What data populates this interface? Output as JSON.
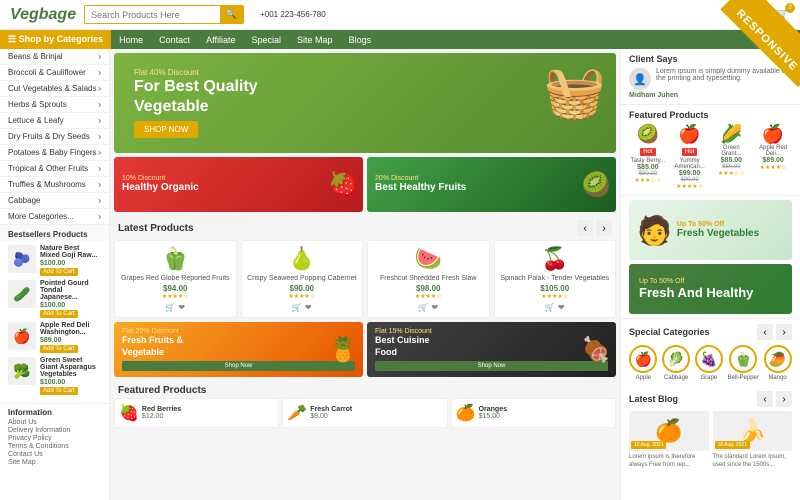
{
  "header": {
    "logo": "Vegbage",
    "search_placeholder": "Search Products Here",
    "phone": "+001 223-456-780",
    "icons": [
      "👤",
      "❤",
      "🛒"
    ],
    "cart_count": "2"
  },
  "nav": {
    "category_label": "☰ Shop by Categories",
    "links": [
      "Home",
      "Contact",
      "Affiliate",
      "Special",
      "Site Map",
      "Blogs"
    ]
  },
  "sidebar": {
    "categories": [
      "Beans & Brinjal",
      "Broccoli & Cauliflower",
      "Cut Vegetables & Salads",
      "Herbs & Sprouts",
      "Lettuce & Leafy",
      "Dry Fruits & Dry Seeds",
      "Potatoes & Baby Fingers",
      "Tropical & Other Fruits",
      "Truffles & Mushrooms",
      "Cabbage",
      "More Categories..."
    ],
    "bestsellers_title": "Bestsellers Products",
    "bestsellers": [
      {
        "name": "Nature Best Mixed Goji Raw...",
        "price": "$100.00",
        "emoji": "🫐"
      },
      {
        "name": "Pointed Gourd Tondal Japanese...",
        "price": "$100.00",
        "emoji": "🥒"
      },
      {
        "name": "Apple Red Deli Washington...",
        "price": "$89.00",
        "emoji": "🍎"
      },
      {
        "name": "Green Sweet Giant Asparagus Vegetables",
        "price": "$100.00",
        "emoji": "🥦"
      }
    ],
    "add_to_cart": "Add To Cart",
    "info_title": "Information",
    "info_links": [
      "About Us",
      "Delivery Information",
      "Privacy Policy",
      "Terms & Conditions",
      "Contact Us",
      "Site Map"
    ],
    "client_says_title": "Client Says"
  },
  "hero": {
    "discount_text": "Flat 40% Discount",
    "title": "For Best Quality\nVegetable",
    "btn_label": "SHOP NOW",
    "emoji": "🧺"
  },
  "small_banners": [
    {
      "discount": "10% Discount",
      "title": "Healthy Organic",
      "emoji": "🍓",
      "class": "banner-red"
    },
    {
      "discount": "20% Discount",
      "title": "Best Healthy Fruits",
      "emoji": "🥝",
      "class": "banner-green"
    }
  ],
  "latest_products": {
    "title": "Latest Products",
    "products": [
      {
        "name": "Grapes Red Globe Reported Fruits",
        "price": "$94.00",
        "emoji": "🫑",
        "rating": "★★★★☆"
      },
      {
        "name": "Crispy Seaweed Popping Cabernet",
        "price": "$90.00",
        "emoji": "🍐",
        "rating": "★★★★☆"
      },
      {
        "name": "Freshcut Shredded Fresh Slaw",
        "price": "$98.00",
        "emoji": "🍉",
        "rating": "★★★★☆"
      },
      {
        "name": "Spinach Palak - Tender Vegetables",
        "price": "$105.00",
        "emoji": "🍒",
        "rating": "★★★★☆"
      }
    ]
  },
  "bottom_banners": [
    {
      "discount": "Flat 20% Discount",
      "title": "Fresh Fruits &\nVegetable",
      "btn": "Shop Now",
      "emoji": "🍍"
    },
    {
      "discount": "Flat 15% Discount",
      "title": "Best Cuisine\nFood",
      "btn": "Shop Now",
      "emoji": "🍖"
    }
  ],
  "featured_bottom": {
    "title": "Featured Products",
    "items": [
      {
        "emoji": "🍓",
        "name": "Red Berries",
        "price": "$12.00"
      },
      {
        "emoji": "🥕",
        "name": "Fresh Carrot",
        "price": "$8.00"
      },
      {
        "emoji": "🍊",
        "name": "Oranges",
        "price": "$15.00"
      }
    ]
  },
  "right_panel": {
    "client_says": {
      "title": "Client Says",
      "avatar": "👤",
      "text": "Lorem ipsum is simply dummy available of the printing and typesetting.",
      "author": "Midham Juhen"
    },
    "featured_products": {
      "title": "Featured Products",
      "products": [
        {
          "emoji": "🥝",
          "badge": "Hot",
          "name": "Tasty Berry...",
          "price": "$85.00",
          "old_price": "$80.00",
          "rating": "★★★☆☆"
        },
        {
          "emoji": "🍎",
          "badge": "Hot",
          "name": "Yummy American...",
          "price": "$99.00",
          "old_price": "$90.00",
          "rating": "★★★★☆"
        },
        {
          "emoji": "🌽",
          "badge": "",
          "name": "Green Grant...",
          "price": "$85.00",
          "old_price": "$80.00",
          "rating": "★★★☆☆"
        },
        {
          "emoji": "🍎",
          "badge": "",
          "name": "Apple Red Deli...",
          "price": "$89.00",
          "old_price": "",
          "rating": "★★★★☆"
        }
      ]
    },
    "fresh_veg_banner": {
      "discount": "Up To 50% Off",
      "title": "Fresh Vegetables",
      "person": "🧑"
    },
    "fresh_healthy_banner": {
      "discount": "Up To 50% Off",
      "title": "Fresh And Healthy"
    },
    "special_categories": {
      "title": "Special Categories",
      "items": [
        {
          "label": "Apple",
          "emoji": "🍎"
        },
        {
          "label": "Cabbage",
          "emoji": "🥬"
        },
        {
          "label": "Grape",
          "emoji": "🍇"
        },
        {
          "label": "Bell-Pepper",
          "emoji": "🫑"
        },
        {
          "label": "Mango",
          "emoji": "🥭"
        }
      ]
    },
    "latest_blog": {
      "title": "Latest Blog",
      "posts": [
        {
          "emoji": "🍊",
          "date": "12 Aug, 2021",
          "text": "Lorem ipsum is therefore always Free from rep..."
        },
        {
          "emoji": "🍌",
          "date": "18 Aug, 2021",
          "text": "The standard Lorem ipsum, used since the 1500s..."
        }
      ]
    }
  },
  "responsive_badge": "RESPONSIVE"
}
